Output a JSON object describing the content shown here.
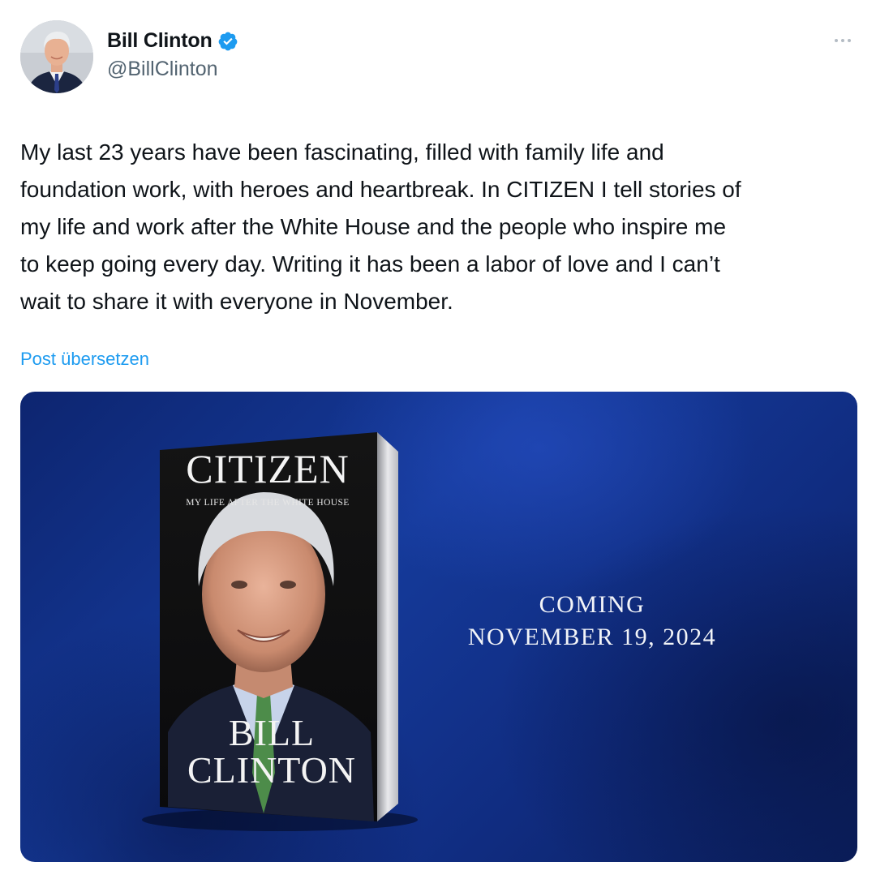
{
  "author": {
    "name": "Bill Clinton",
    "handle": "@BillClinton",
    "verified": true
  },
  "post": {
    "text": "My last 23 years have been fascinating, filled with family life and\nfoundation work, with heroes and heartbreak. In CITIZEN I tell stories of\nmy life and work after the White House and the people who inspire me\nto keep going every day. Writing it has been a labor of love and I can’t\nwait to share it with everyone in November.",
    "translate_label": "Post übersetzen"
  },
  "media": {
    "book": {
      "title": "CITIZEN",
      "subtitle": "MY LIFE AFTER THE WHITE HOUSE",
      "author_line1": "BILL",
      "author_line2": "CLINTON"
    },
    "announcement": {
      "line1": "COMING",
      "line2": "NOVEMBER 19, 2024"
    }
  },
  "icons": {
    "verified": "verified-badge-icon",
    "more": "more-options-icon"
  },
  "colors": {
    "link": "#1d9bf0",
    "verified": "#1d9bf0",
    "secondary_text": "#536471",
    "media_background": "#123488"
  }
}
